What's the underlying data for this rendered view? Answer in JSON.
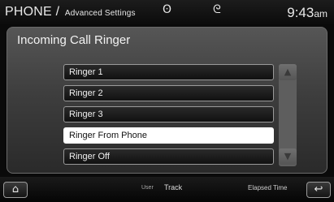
{
  "header": {
    "title": "PHONE",
    "separator": "/",
    "subtitle": "Advanced Settings",
    "bluetooth_icon": "ʘ",
    "signal_icon": "ᘓ",
    "clock_time": "9:43",
    "clock_ampm": "am"
  },
  "panel": {
    "title": "Incoming Call Ringer",
    "options": [
      {
        "label": "Ringer 1",
        "selected": false
      },
      {
        "label": "Ringer 2",
        "selected": false
      },
      {
        "label": "Ringer 3",
        "selected": false
      },
      {
        "label": "Ringer From Phone",
        "selected": true
      },
      {
        "label": "Ringer Off",
        "selected": false
      }
    ],
    "scroll_up_glyph": "▲",
    "scroll_down_glyph": "▼"
  },
  "footer": {
    "home_glyph": "⌂",
    "user_label": "User",
    "track_label": "Track",
    "elapsed_label": "Elapsed Time",
    "back_glyph": "↩"
  },
  "colors": {
    "selected_bg": "#ffffff",
    "panel_bg": "#4a4a4a"
  }
}
